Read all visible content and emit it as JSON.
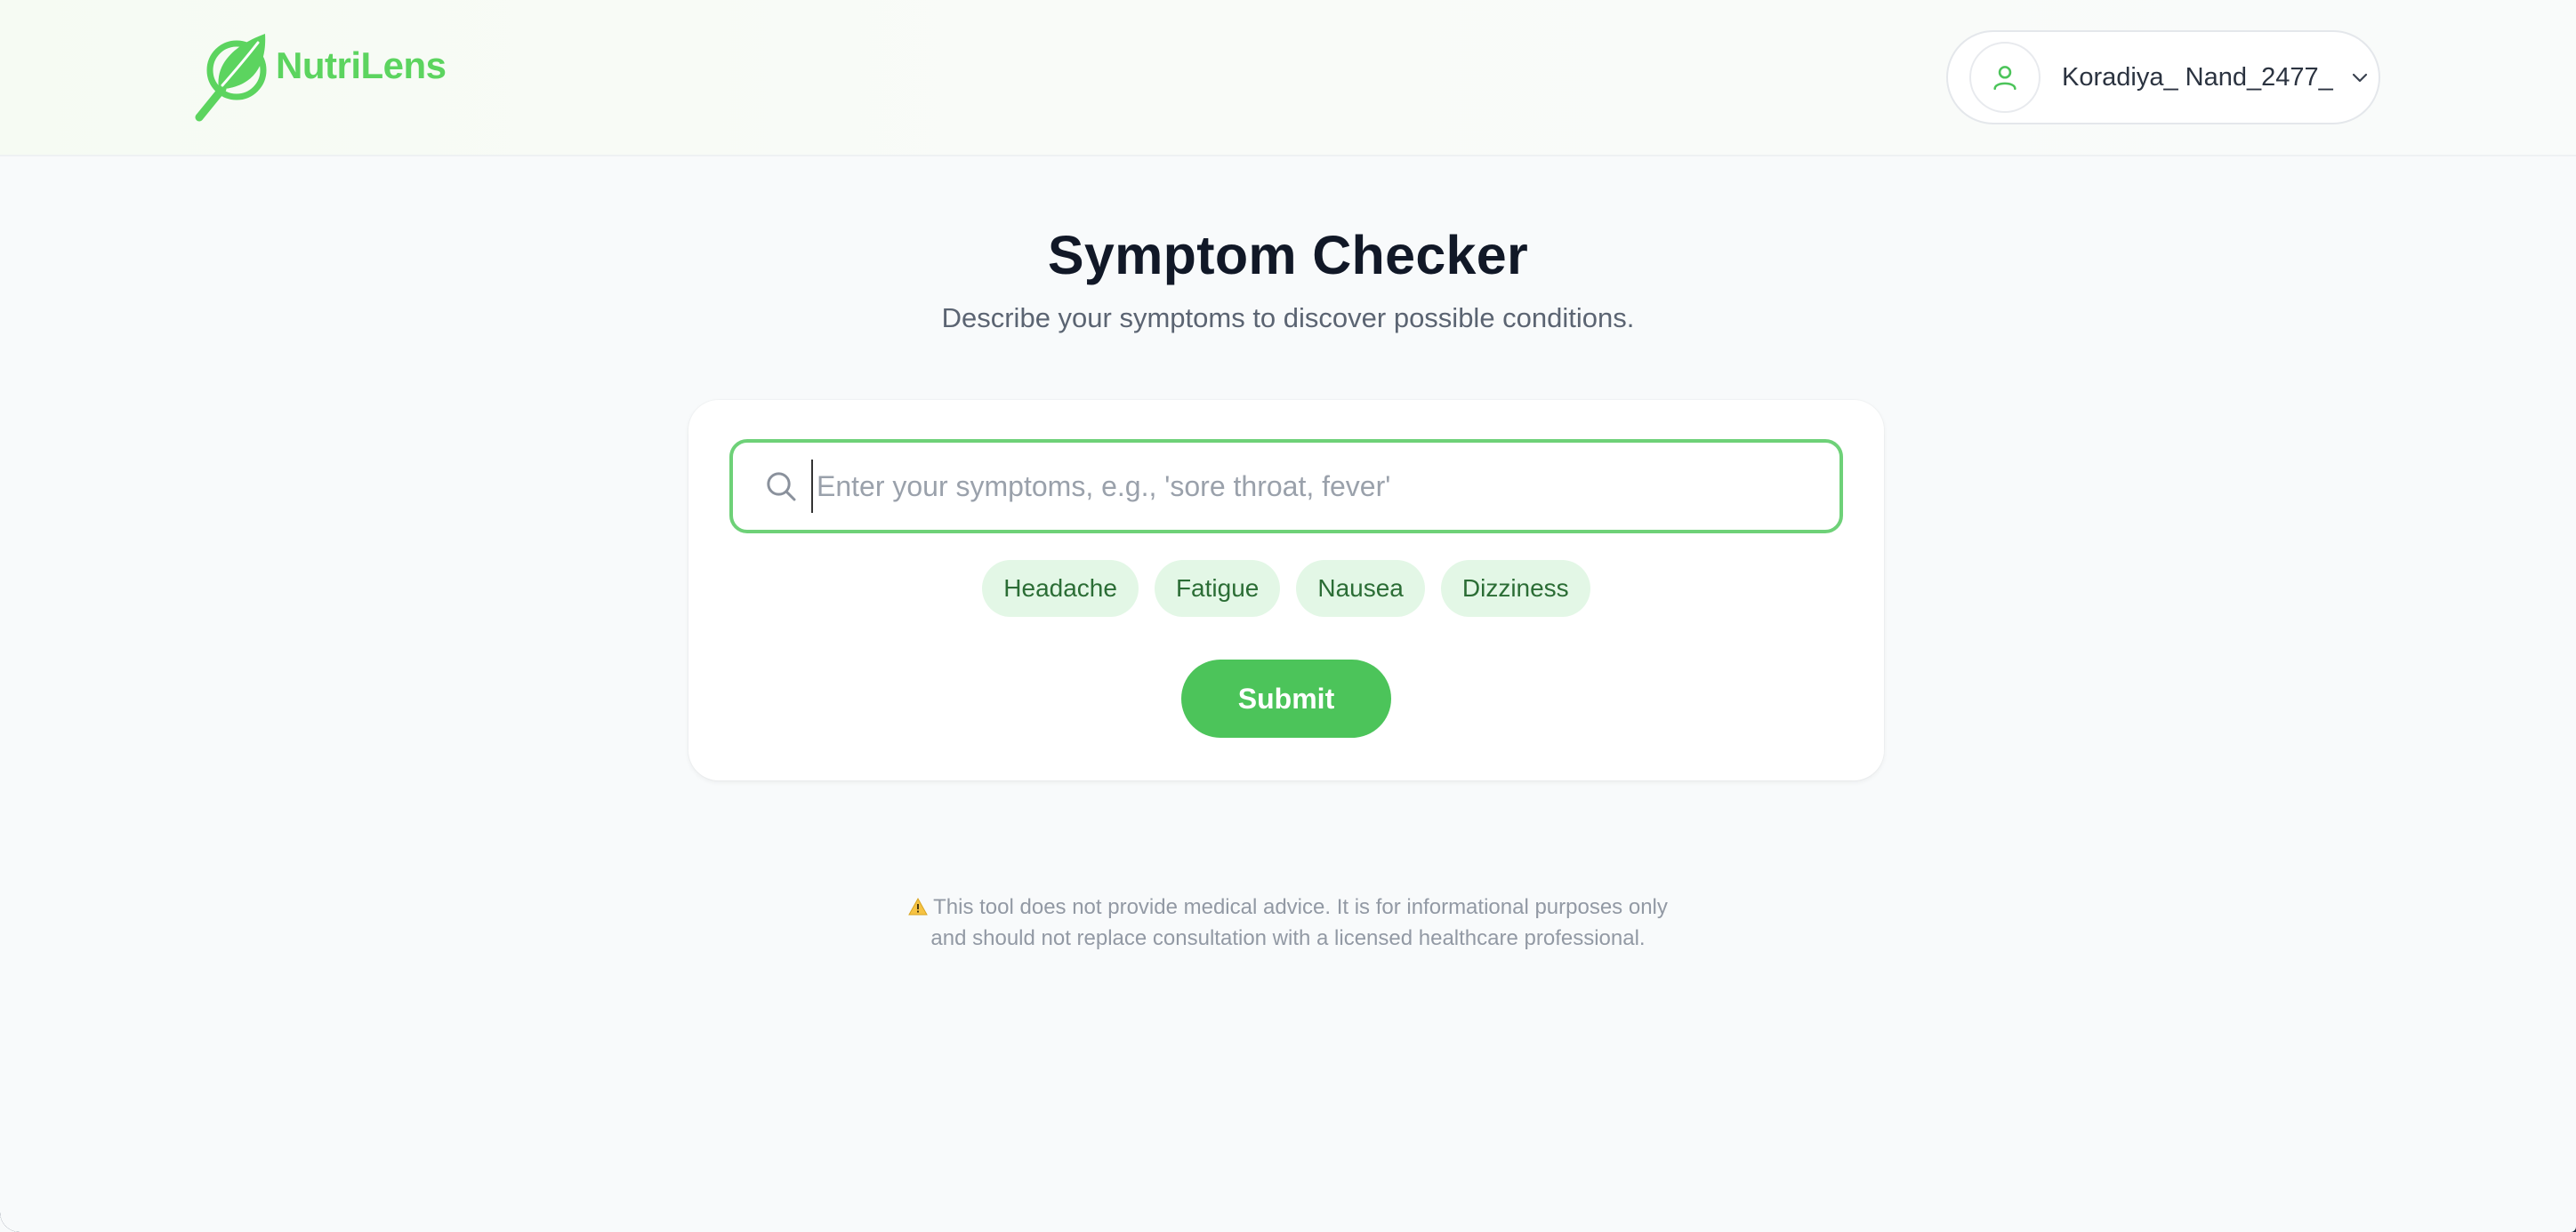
{
  "header": {
    "brand_name": "NutriLens",
    "brand_color": "#5cd45f",
    "user": {
      "name": "Koradiya_ Nand_2477_",
      "avatar_icon": "user-icon",
      "menu_icon": "chevron-down-icon"
    }
  },
  "main": {
    "title": "Symptom Checker",
    "subtitle": "Describe your symptoms to discover possible conditions.",
    "search": {
      "icon": "search-icon",
      "value": "",
      "placeholder": "Enter your symptoms, e.g., 'sore throat, fever'"
    },
    "suggestions": [
      "Headache",
      "Fatigue",
      "Nausea",
      "Dizziness"
    ],
    "submit_label": "Submit",
    "accent_color": "#4cc45a"
  },
  "footer": {
    "warning_icon": "warning-icon",
    "disclaimer_line1": "This tool does not provide medical advice. It is for informational purposes only",
    "disclaimer_line2": "and should not replace consultation with a licensed healthcare professional."
  }
}
